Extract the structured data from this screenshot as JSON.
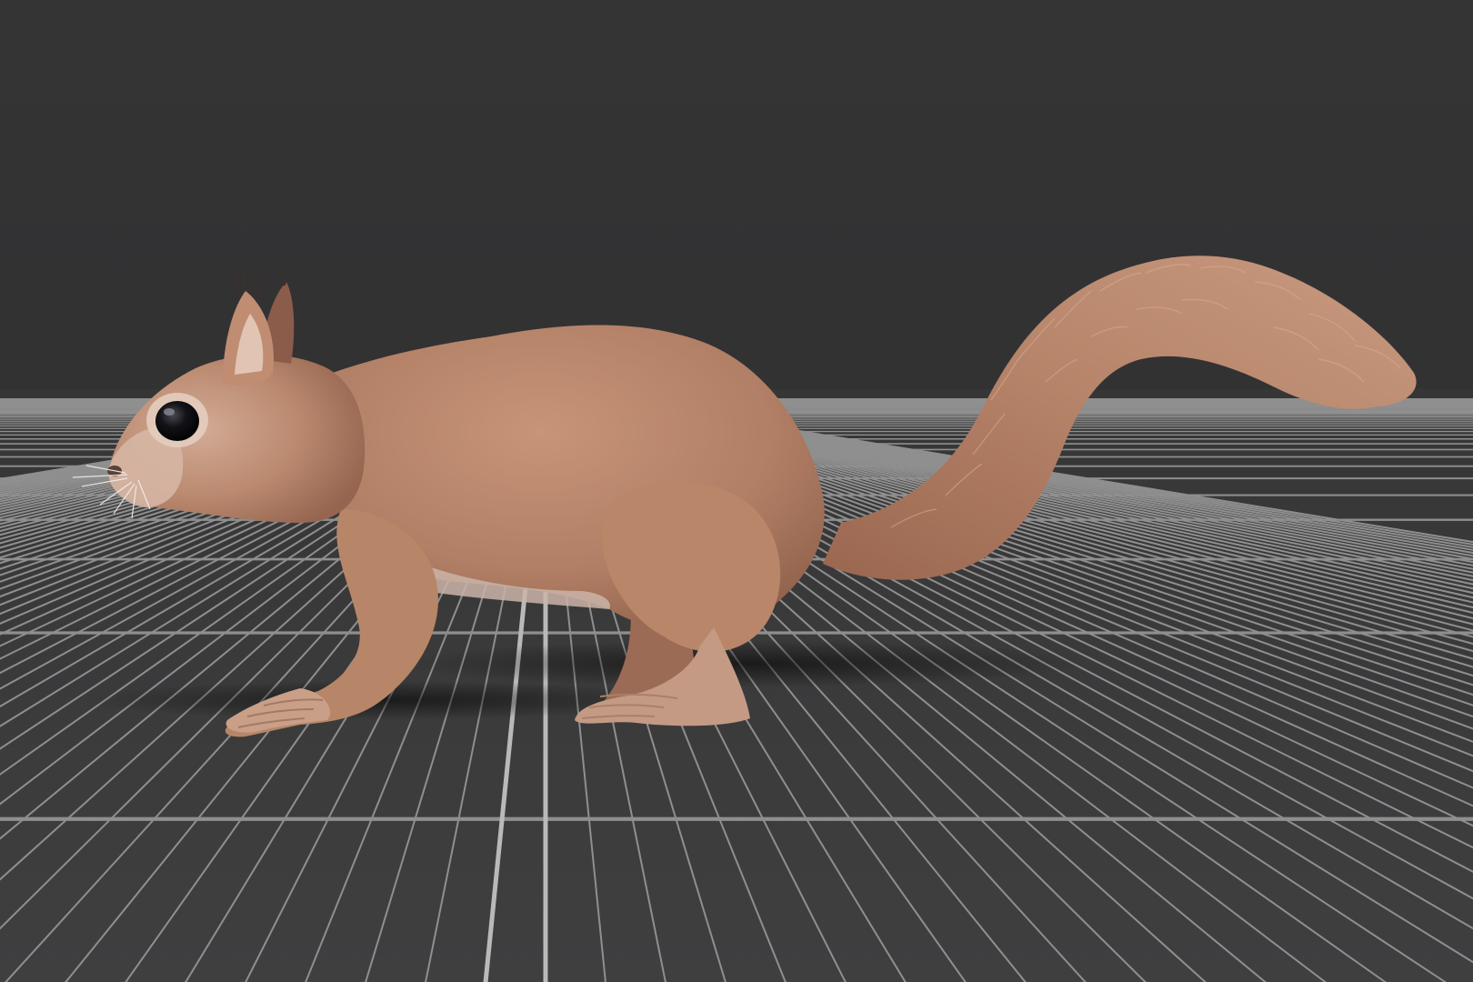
{
  "viewport": {
    "mode": "3d-model-preview",
    "model": "squirrel",
    "view": "side",
    "ground_grid": true
  },
  "colors": {
    "background": "#333334",
    "floor": "#3d3d3e",
    "grid_line": "#8f8f8f",
    "grid_axis": "#b9b9b9",
    "fur": "#b8876d",
    "fur_dark": "#7f5443",
    "belly": "#c9b2a6",
    "eye": "#0c0c10"
  }
}
